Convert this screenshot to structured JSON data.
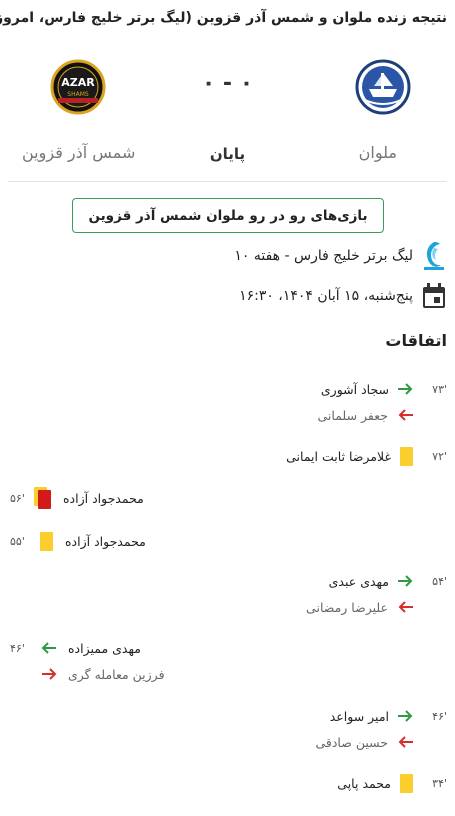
{
  "page_title": "نتیجه زنده ملوان و شمس آذر قزوین (لیگ برتر خلیج فارس، امروز)",
  "match": {
    "home_team": "ملوان",
    "away_team": "شمس آذر قزوین",
    "score": "۰ - ۰",
    "status": "پایان",
    "away_logo_text_top": "AZAR",
    "away_logo_text_bottom": "SHAMS"
  },
  "pre_match_button": "بازی‌های رو در رو ملوان شمس آذر قزوین",
  "league": "لیگ برتر خلیج فارس - هفته ۱۰",
  "datetime": "پنج‌شنبه، ۱۵ آبان ۱۴۰۴، ۱۶:۳۰",
  "events_title": "اتفاقات",
  "events": [
    {
      "side": "home",
      "type": "substitution",
      "minute": "۷۳'",
      "player_in": "سجاد آشوری",
      "player_out": "جعفر سلمانی"
    },
    {
      "side": "home",
      "type": "yellow",
      "minute": "۷۲'",
      "player": "غلامرضا ثابت ایمانی"
    },
    {
      "side": "away",
      "type": "second-yellow",
      "minute": "۵۶'",
      "player": "محمدجواد آزاده"
    },
    {
      "side": "away",
      "type": "yellow",
      "minute": "۵۵'",
      "player": "محمدجواد آزاده"
    },
    {
      "side": "home",
      "type": "substitution",
      "minute": "۵۴'",
      "player_in": "مهدی عبدی",
      "player_out": "علیرضا رمضانی"
    },
    {
      "side": "away",
      "type": "substitution",
      "minute": "۴۶'",
      "player_in": "مهدی ممیزاده",
      "player_out": "فرزین معامله گری"
    },
    {
      "side": "home",
      "type": "substitution",
      "minute": "۴۶'",
      "player_in": "امیر سواعد",
      "player_out": "حسین صادقی"
    },
    {
      "side": "home",
      "type": "yellow",
      "minute": "۳۴'",
      "player": "محمد پاپی"
    }
  ],
  "colors": {
    "accent_green": "#3a9b5c",
    "in_arrow": "#2e9a44",
    "out_arrow": "#d32f2f",
    "yellow_card": "#fbcd2d",
    "red_card": "#d31a1a"
  }
}
